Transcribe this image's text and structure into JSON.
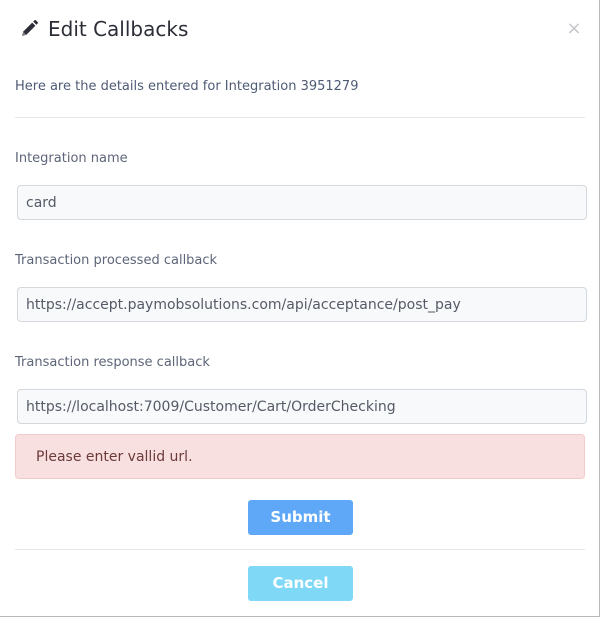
{
  "dialog": {
    "title": "Edit Callbacks",
    "close_symbol": "×",
    "subtitle": "Here are the details entered for Integration 3951279"
  },
  "form": {
    "integration_name": {
      "label": "Integration name",
      "value": "card"
    },
    "transaction_processed_callback": {
      "label": "Transaction processed callback",
      "value": "https://accept.paymobsolutions.com/api/acceptance/post_pay"
    },
    "transaction_response_callback": {
      "label": "Transaction response callback",
      "value": "https://localhost:7009/Customer/Cart/OrderChecking"
    }
  },
  "alert": {
    "message": "Please enter vallid url."
  },
  "buttons": {
    "submit_label": "Submit",
    "cancel_label": "Cancel"
  },
  "icons": {
    "title_icon": "pencil-icon",
    "close_icon": "close-icon"
  },
  "colors": {
    "submit_button": "#5ea8f7",
    "cancel_button": "#7ed8f6",
    "alert_background": "#f9e0e0",
    "alert_text": "#6b3a3a"
  }
}
